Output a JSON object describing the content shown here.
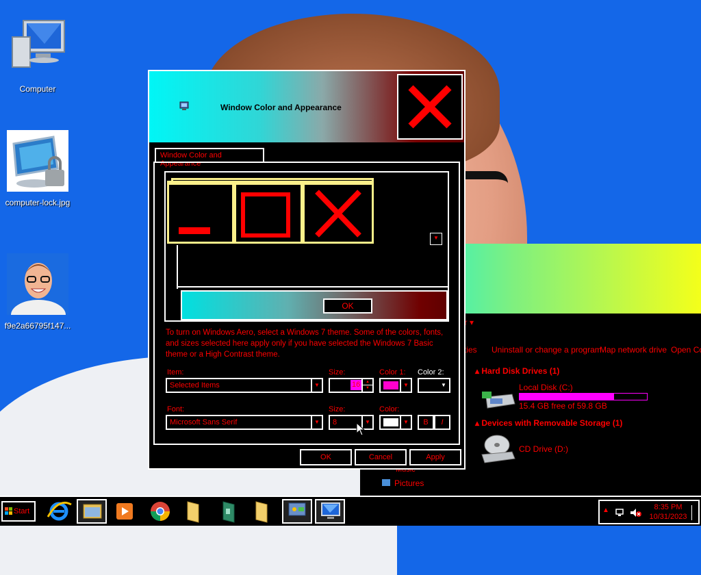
{
  "desktop": {
    "icons": [
      {
        "label": "Computer"
      },
      {
        "label": "computer-lock.jpg"
      },
      {
        "label": "f9e2a66795f147..."
      }
    ]
  },
  "explorer": {
    "address_fragment": "er ▾",
    "commands": [
      "ties",
      "Uninstall or change a program",
      "Map network drive",
      "Open Co"
    ],
    "groups": {
      "hard_disk": "Hard Disk Drives (1)",
      "removable": "Devices with Removable Storage (1)"
    },
    "local_disk": {
      "name": "Local Disk (C:)",
      "free": "15.4 GB free of 59.8 GB",
      "used_fraction": 0.74
    },
    "cd_drive": {
      "name": "CD Drive (D:)"
    },
    "nav": {
      "music": "Music",
      "pictures": "Pictures"
    }
  },
  "dialog": {
    "title": "Window Color and Appearance",
    "tab": "Window Color and Appearance",
    "preview_ok": "OK",
    "info_text": "To turn on Windows Aero, select a Windows 7 theme.  Some of the colors, fonts, and sizes selected here apply only if you have selected the Windows 7 Basic theme or a High Contrast theme.",
    "labels": {
      "item": "Item:",
      "size": "Size:",
      "color1": "Color 1:",
      "color2": "Color 2:",
      "font": "Font:",
      "font_size": "Size:",
      "color": "Color:"
    },
    "item_value": "Selected Items",
    "size_value": "16",
    "font_value": "Microsoft Sans Serif",
    "font_size_value": "8",
    "bold_label": "B",
    "italic_label": "I",
    "buttons": {
      "ok": "OK",
      "cancel": "Cancel",
      "apply": "Apply"
    },
    "colors": {
      "color1": "#ff00cc",
      "font_color": "#ffffff"
    }
  },
  "taskbar": {
    "start_label": "Start",
    "time": "8:35 PM",
    "date": "10/31/2023"
  }
}
